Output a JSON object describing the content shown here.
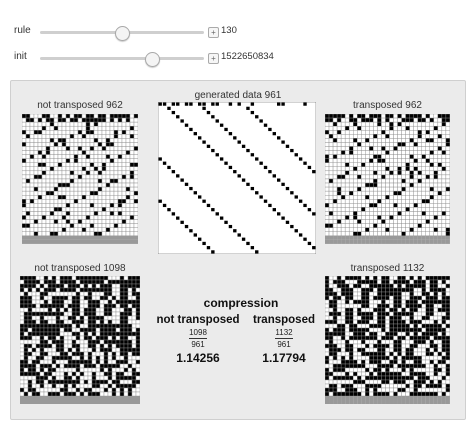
{
  "controls": {
    "rule": {
      "label": "rule",
      "value": "130",
      "fraction": 0.5
    },
    "init": {
      "label": "init",
      "value": "1522650834",
      "fraction": 0.68
    }
  },
  "panels": {
    "nt962": {
      "label": "not transposed 962"
    },
    "gen": {
      "label": "generated data 961"
    },
    "tr962": {
      "label": "transposed 962"
    },
    "nt1098": {
      "label": "not transposed 1098"
    },
    "tr1132": {
      "label": "transposed 1132"
    }
  },
  "compression": {
    "title": "compression",
    "not_transposed": {
      "label": "not transposed",
      "numerator": "1098",
      "denominator": "961",
      "ratio": "1.14256"
    },
    "transposed": {
      "label": "transposed",
      "numerator": "1132",
      "denominator": "961",
      "ratio": "1.17794"
    }
  },
  "icons": {
    "slider_plus": "plus-icon"
  },
  "colors": {
    "cell_black": "#000000",
    "cell_white": "#ffffff",
    "grid_line": "#8a8a8a",
    "gray_row": "#999999",
    "panel_bg": "#ebebeb"
  }
}
